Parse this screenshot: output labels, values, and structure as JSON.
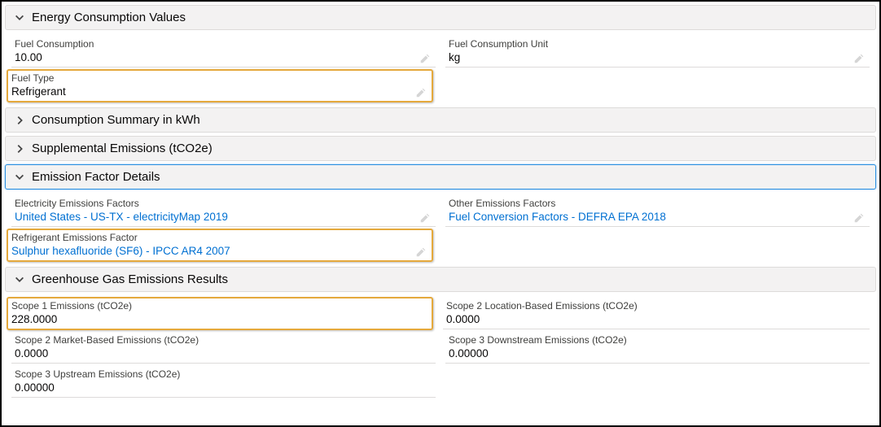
{
  "sections": {
    "energy": {
      "title": "Energy Consumption Values"
    },
    "consumption_summary": {
      "title": "Consumption Summary in kWh"
    },
    "supplemental": {
      "title": "Supplemental Emissions (tCO2e)"
    },
    "emission_factor": {
      "title": "Emission Factor Details"
    },
    "ghg": {
      "title": "Greenhouse Gas Emissions Results"
    }
  },
  "energy_fields": {
    "fuel_consumption": {
      "label": "Fuel Consumption",
      "value": "10.00"
    },
    "fuel_consumption_unit": {
      "label": "Fuel Consumption Unit",
      "value": "kg"
    },
    "fuel_type": {
      "label": "Fuel Type",
      "value": "Refrigerant"
    }
  },
  "emission_factor_fields": {
    "electricity": {
      "label": "Electricity Emissions Factors",
      "value": "United States - US-TX - electricityMap 2019"
    },
    "other": {
      "label": "Other Emissions Factors",
      "value": "Fuel Conversion Factors - DEFRA EPA 2018"
    },
    "refrigerant": {
      "label": "Refrigerant Emissions Factor",
      "value": "Sulphur hexafluoride (SF6) - IPCC AR4 2007"
    }
  },
  "ghg_fields": {
    "scope1": {
      "label": "Scope 1 Emissions (tCO2e)",
      "value": "228.0000"
    },
    "scope2_loc": {
      "label": "Scope 2 Location-Based Emissions (tCO2e)",
      "value": "0.0000"
    },
    "scope2_mkt": {
      "label": "Scope 2 Market-Based Emissions (tCO2e)",
      "value": "0.0000"
    },
    "scope3_down": {
      "label": "Scope 3 Downstream Emissions (tCO2e)",
      "value": "0.00000"
    },
    "scope3_up": {
      "label": "Scope 3 Upstream Emissions (tCO2e)",
      "value": "0.00000"
    }
  }
}
